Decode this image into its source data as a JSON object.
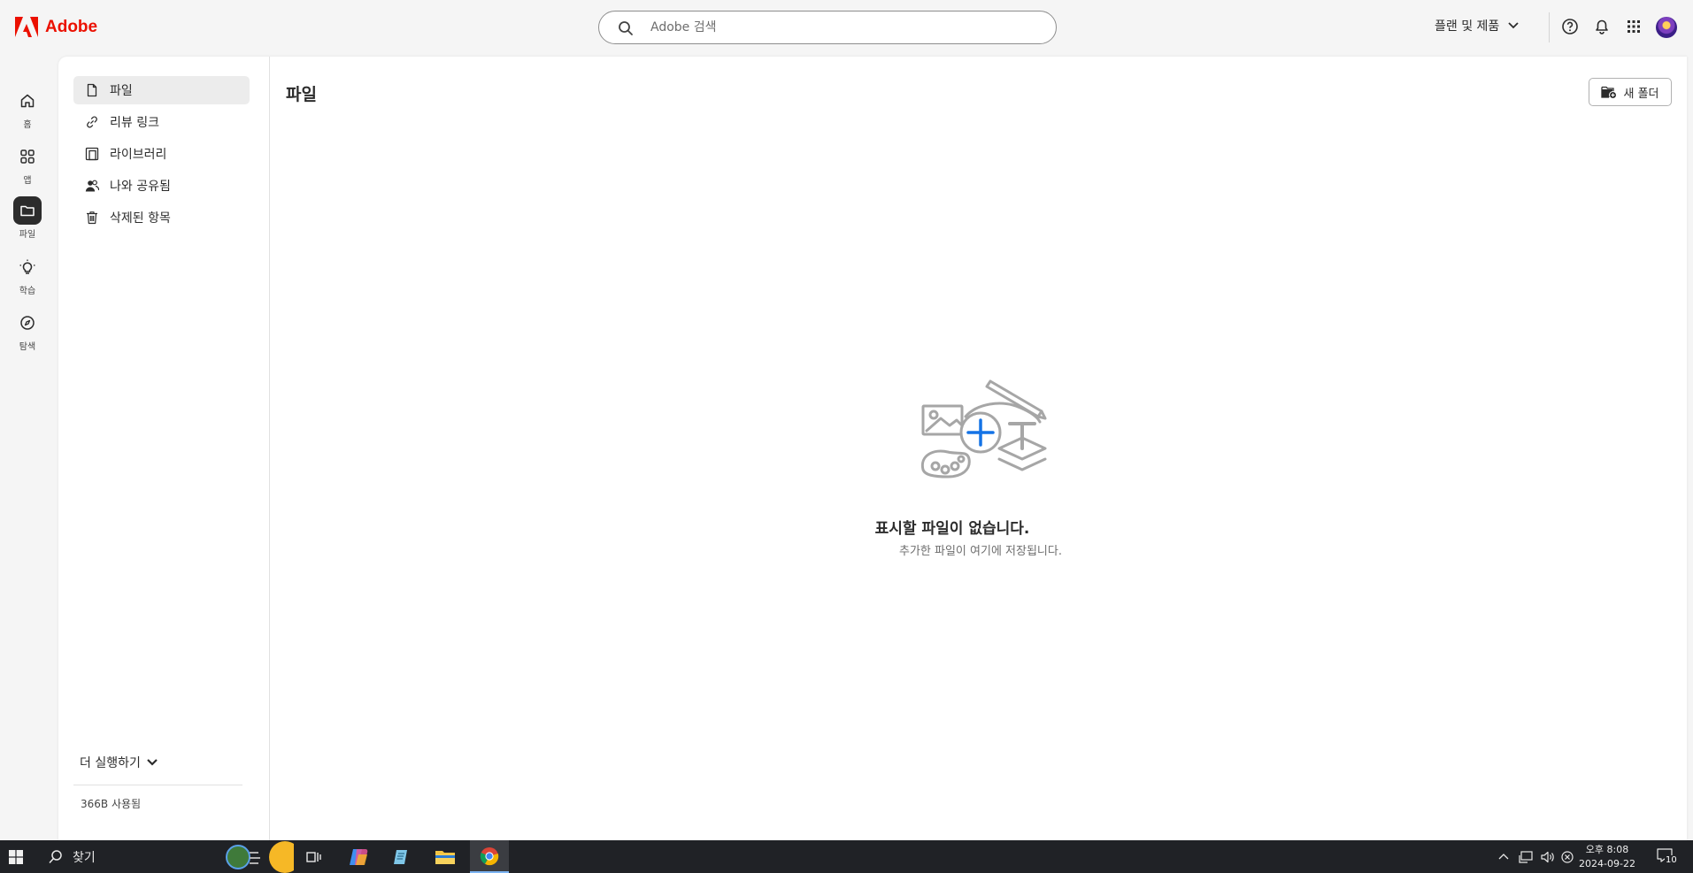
{
  "header": {
    "logo_text": "Adobe",
    "search_placeholder": "Adobe 검색",
    "plans_label": "플랜 및 제품",
    "brand_color": "#eb1000"
  },
  "rail": {
    "items": [
      {
        "label": "홈",
        "icon": "home-icon"
      },
      {
        "label": "앱",
        "icon": "apps-icon"
      },
      {
        "label": "파일",
        "icon": "folder-icon",
        "active": true
      },
      {
        "label": "학습",
        "icon": "lightbulb-icon"
      },
      {
        "label": "탐색",
        "icon": "compass-icon"
      }
    ]
  },
  "subnav": {
    "items": [
      {
        "label": "파일",
        "icon": "file-icon",
        "active": true
      },
      {
        "label": "리뷰 링크",
        "icon": "link-icon"
      },
      {
        "label": "라이브러리",
        "icon": "library-icon"
      },
      {
        "label": "나와 공유됨",
        "icon": "shared-users-icon"
      },
      {
        "label": "삭제된 항목",
        "icon": "trash-icon"
      }
    ],
    "more_label": "더 실행하기",
    "usage_text": "366B 사용됨"
  },
  "main": {
    "title": "파일",
    "new_folder_label": "새 폴더",
    "empty_title": "표시할 파일이 없습니다.",
    "empty_subtitle": "추가한 파일이 여기에 저장됩니다."
  },
  "taskbar": {
    "search_label": "찾기",
    "time": "오후 8:08",
    "date": "2024-09-22",
    "notification_count": "10"
  }
}
